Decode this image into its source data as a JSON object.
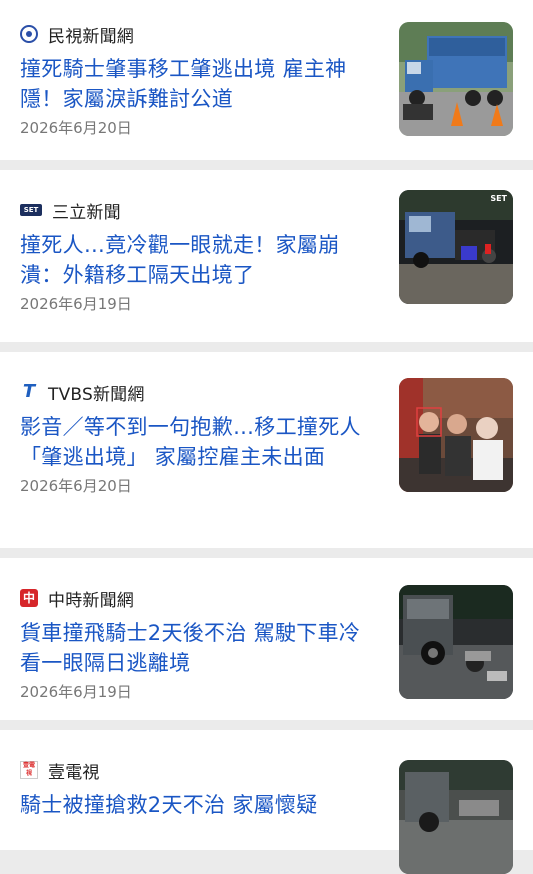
{
  "articles": [
    {
      "source": "民視新聞網",
      "source_icon": "minshi-logo-icon",
      "title": "撞死騎士肇事移工肇逃出境 雇主神隱！家屬淚訴難討公道",
      "date": "2026年6月20日",
      "thumb": "truck-crash-thumbnail"
    },
    {
      "source": "三立新聞",
      "source_icon": "set-logo-icon",
      "icon_text": "SET",
      "title": "撞死人…竟冷觀一眼就走！家屬崩潰：外籍移工隔天出境了",
      "date": "2026年6月19日",
      "thumb": "night-crash-thumbnail",
      "thumb_badge": "SET"
    },
    {
      "source": "TVBS新聞網",
      "source_icon": "tvbs-logo-icon",
      "icon_text": "T",
      "title": "影音／等不到一句抱歉…移工撞死人「肇逃出境」 家屬控雇主未出面",
      "date": "2026年6月20日",
      "thumb": "family-photo-thumbnail"
    },
    {
      "source": "中時新聞網",
      "source_icon": "chinatimes-logo-icon",
      "icon_text": "中",
      "title": "貨車撞飛騎士2天後不治 駕駛下車冷看一眼隔日逃離境",
      "date": "2026年6月19日",
      "thumb": "motorcycle-wreck-thumbnail"
    },
    {
      "source": "壹電視",
      "source_icon": "nexttv-logo-icon",
      "icon_text": "壹電視",
      "title": "騎士被撞搶救2天不治 家屬懷疑",
      "date": "",
      "thumb": "scene-thumbnail"
    }
  ],
  "colors": {
    "title": "#1a56c4",
    "background": "#ebebeb",
    "card": "#ffffff"
  }
}
